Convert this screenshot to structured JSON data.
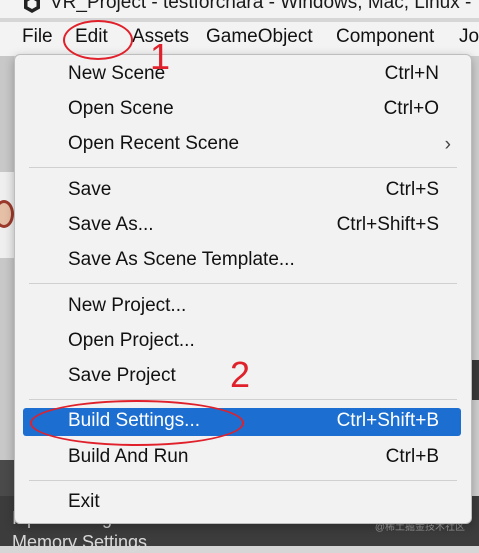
{
  "window": {
    "title": "VR_Project - testforchara - Windows, Mac, Linux -"
  },
  "menubar": {
    "items": [
      {
        "label": "File"
      },
      {
        "label": "Edit"
      },
      {
        "label": "Assets"
      },
      {
        "label": "GameObject"
      },
      {
        "label": "Component"
      },
      {
        "label": "Jo"
      }
    ]
  },
  "dropdown": {
    "items": [
      {
        "label": "New Scene",
        "shortcut": "Ctrl+N"
      },
      {
        "label": "Open Scene",
        "shortcut": "Ctrl+O"
      },
      {
        "label": "Open Recent Scene",
        "shortcut": "",
        "submenu": true,
        "chevron": "›"
      },
      {
        "label": "Save",
        "shortcut": "Ctrl+S"
      },
      {
        "label": "Save As...",
        "shortcut": "Ctrl+Shift+S"
      },
      {
        "label": "Save As Scene Template...",
        "shortcut": ""
      },
      {
        "label": "New Project...",
        "shortcut": ""
      },
      {
        "label": "Open Project...",
        "shortcut": ""
      },
      {
        "label": "Save Project",
        "shortcut": ""
      },
      {
        "label": "Build Settings...",
        "shortcut": "Ctrl+Shift+B",
        "selected": true
      },
      {
        "label": "Build And Run",
        "shortcut": "Ctrl+B"
      },
      {
        "label": "Exit",
        "shortcut": ""
      }
    ]
  },
  "background": {
    "bottom_items": [
      "Input Manager",
      "Memory Settings"
    ],
    "watermark": "@稀土掘金技术社区"
  },
  "annotations": {
    "step1": "1",
    "step2": "2"
  },
  "colors": {
    "selection": "#1c6fd1",
    "annotation": "#e0202a",
    "menu_bg": "#f2f2f2"
  }
}
